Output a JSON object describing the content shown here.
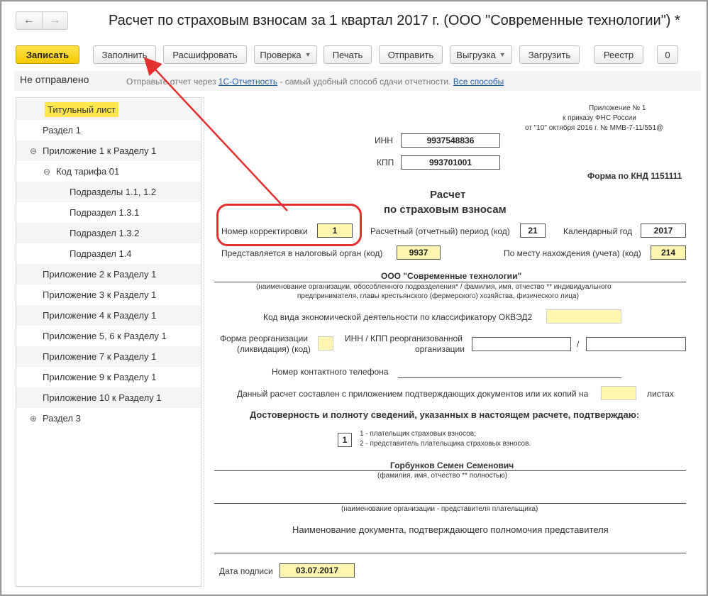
{
  "window": {
    "title": "Расчет по страховым взносам за 1 квартал 2017 г. (ООО \"Современные технологии\") *",
    "back_icon": "←",
    "forward_icon": "→"
  },
  "toolbar": {
    "save": "Записать",
    "fill": "Заполнить",
    "decode": "Расшифровать",
    "check": "Проверка",
    "print": "Печать",
    "send": "Отправить",
    "export": "Выгрузка",
    "load": "Загрузить",
    "registry": "Реестр",
    "attach_icon": "0"
  },
  "status": {
    "state": "Не отправлено",
    "msg_prefix": "Отправьте отчет через ",
    "msg_link": "1С-Отчетность",
    "msg_middle": " - самый удобный способ сдачи отчетности. ",
    "msg_link2": "Все способы"
  },
  "tree": [
    {
      "label": "Титульный лист",
      "selected": true
    },
    {
      "label": "Раздел 1"
    },
    {
      "label": "Приложение 1 к Разделу 1",
      "toggle": "⊖"
    },
    {
      "label": "Код тарифа 01",
      "toggle": "⊖"
    },
    {
      "label": "Подразделы 1.1, 1.2"
    },
    {
      "label": "Подраздел 1.3.1"
    },
    {
      "label": "Подраздел 1.3.2"
    },
    {
      "label": "Подраздел 1.4"
    },
    {
      "label": "Приложение 2 к Разделу 1"
    },
    {
      "label": "Приложение 3 к Разделу 1"
    },
    {
      "label": "Приложение 4 к Разделу 1"
    },
    {
      "label": "Приложение 5, 6 к Разделу 1"
    },
    {
      "label": "Приложение 7 к Разделу 1"
    },
    {
      "label": "Приложение 9 к Разделу 1"
    },
    {
      "label": "Приложение 10 к Разделу 1"
    },
    {
      "label": "Раздел 3",
      "toggle": "⊕"
    }
  ],
  "form": {
    "appendix_l1": "Приложение № 1",
    "appendix_l2": "к приказу ФНС России",
    "appendix_l3": "от \"10\" октября 2016 г. № ММВ-7-11/551@",
    "inn_label": "ИНН",
    "inn_value": "9937548836",
    "kpp_label": "КПП",
    "kpp_value": "993701001",
    "knd": "Форма по КНД 1151111",
    "heading_1": "Расчет",
    "heading_2": "по страховым взносам",
    "correction_label": "Номер корректировки",
    "correction_value": "1",
    "period_label": "Расчетный (отчетный) период (код)",
    "period_value": "21",
    "year_label": "Календарный год",
    "year_value": "2017",
    "tax_authority_label": "Представляется в налоговый орган (код)",
    "tax_authority_value": "9937",
    "location_label": "По месту нахождения (учета) (код)",
    "location_value": "214",
    "org_name": "ООО \"Современные технологии\"",
    "org_caption_1": "(наименование организации, обособленного подразделения* / фамилия, имя, отчество ** индивидуального",
    "org_caption_2": "предпринимателя, главы крестьянского (фермерского) хозяйства, физического лица)",
    "okved_label": "Код вида экономической деятельности по классификатору ОКВЭД2",
    "reorg_label_1": "Форма реорганизации",
    "reorg_label_2": "(ликвидация) (код)",
    "reorg_inn_label_1": "ИНН / КПП реорганизованной",
    "reorg_inn_label_2": "организации",
    "slash": "/",
    "phone_label": "Номер контактного телефона",
    "pages_label": "Данный расчет составлен с приложением подтверждающих документов или их копий на",
    "pages_suffix": "листах",
    "confirm_heading": "Достоверность и полноту сведений, указанных в настоящем расчете, подтверждаю:",
    "payer_code": "1",
    "payer_opt_1": "1 - плательщик страховых взносов;",
    "payer_opt_2": "2 - представитель плательщика страховых взносов.",
    "signer_name": "Горбунков Семен Семенович",
    "signer_caption": "(фамилия, имя, отчество **  полностью)",
    "rep_org_caption": "(наименование организации - представителя плательщика)",
    "authority_doc": "Наименование документа, подтверждающего полномочия представителя",
    "sign_date_label": "Дата подписи",
    "sign_date_value": "03.07.2017"
  },
  "colors": {
    "accent_yellow": "#f5c800",
    "input_yellow": "#fff6b0",
    "annotation_red": "#e53030",
    "link_blue": "#1c5fb5"
  }
}
